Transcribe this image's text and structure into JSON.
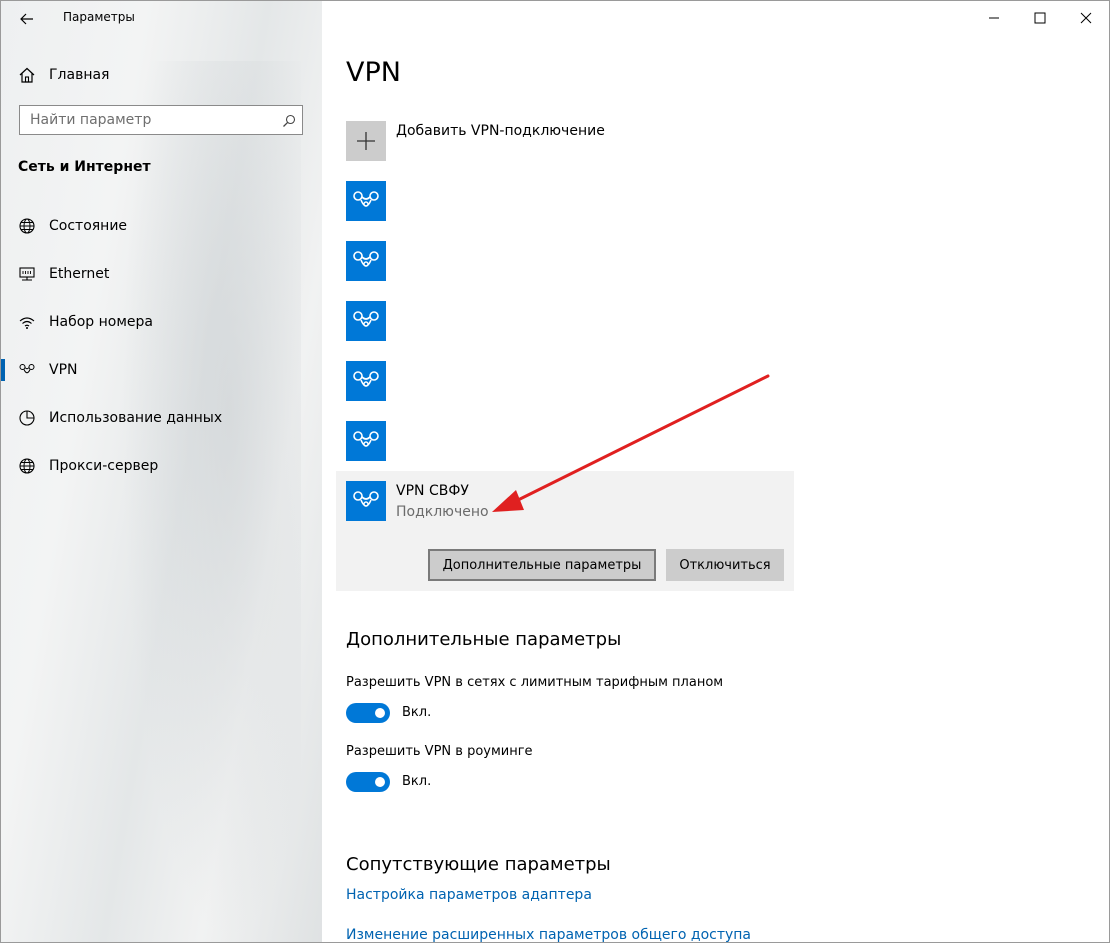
{
  "window": {
    "title": "Параметры"
  },
  "sidebar": {
    "home_label": "Главная",
    "search": {
      "placeholder": "Найти параметр",
      "value": ""
    },
    "section_heading": "Сеть и Интернет",
    "items": [
      {
        "label": "Состояние",
        "icon": "globe-icon"
      },
      {
        "label": "Ethernet",
        "icon": "ethernet-icon"
      },
      {
        "label": "Набор номера",
        "icon": "dialup-icon"
      },
      {
        "label": "VPN",
        "icon": "vpn-icon",
        "active": true
      },
      {
        "label": "Использование данных",
        "icon": "data-usage-icon"
      },
      {
        "label": "Прокси-сервер",
        "icon": "globe-icon"
      }
    ]
  },
  "main": {
    "title": "VPN",
    "add_vpn_label": "Добавить VPN-подключение",
    "connections": [
      {
        "name": "",
        "status": ""
      },
      {
        "name": "",
        "status": ""
      },
      {
        "name": "",
        "status": ""
      },
      {
        "name": "",
        "status": ""
      },
      {
        "name": "",
        "status": ""
      },
      {
        "name": "VPN СВФУ",
        "status": "Подключено",
        "selected": true
      }
    ],
    "buttons": {
      "advanced": "Дополнительные параметры",
      "disconnect": "Отключиться"
    },
    "advanced_heading": "Дополнительные параметры",
    "settings": [
      {
        "label": "Разрешить VPN в сетях с лимитным тарифным планом",
        "state": "Вкл.",
        "on": true
      },
      {
        "label": "Разрешить VPN в роуминге",
        "state": "Вкл.",
        "on": true
      }
    ],
    "related_heading": "Сопутствующие параметры",
    "links": [
      "Настройка параметров адаптера",
      "Изменение расширенных параметров общего доступа"
    ]
  },
  "colors": {
    "accent": "#0078d7",
    "link": "#0063b1",
    "annotation_arrow": "#e02020"
  }
}
